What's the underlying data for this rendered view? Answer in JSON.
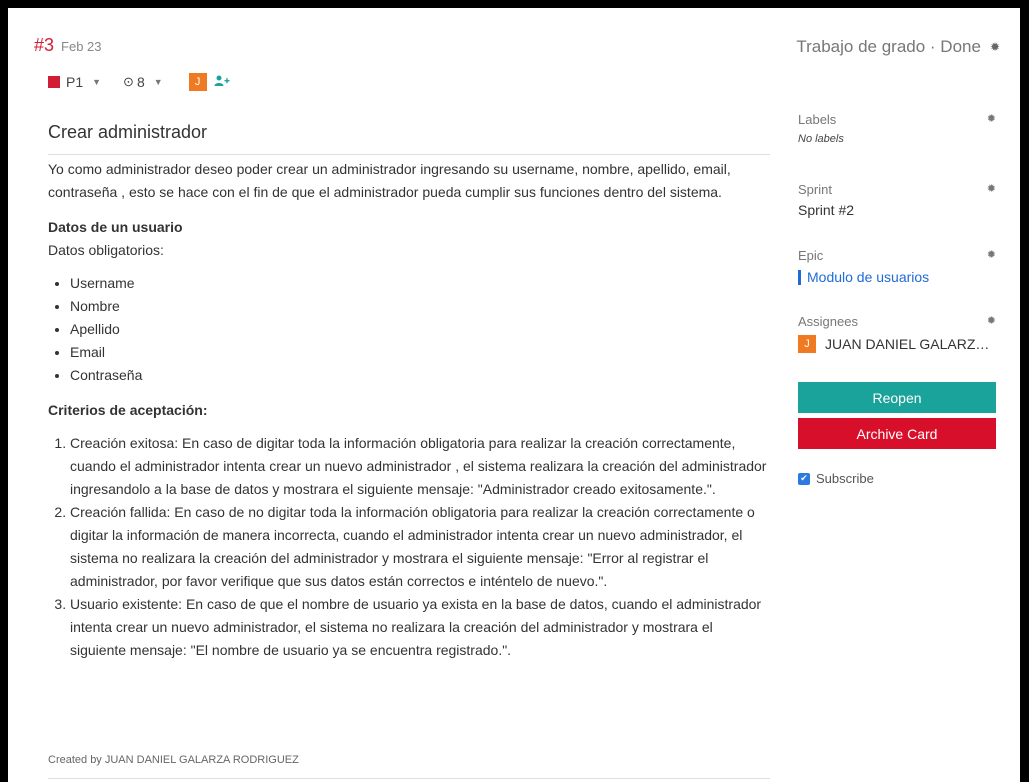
{
  "header": {
    "issue_number": "#3",
    "date": "Feb 23",
    "project_status": "Trabajo de grado · Done"
  },
  "toolbar": {
    "priority": "P1",
    "points": "8",
    "assignee_initial": "J"
  },
  "card": {
    "title": "Crear administrador",
    "description": "Yo como administrador deseo poder crear un administrador ingresando su username, nombre, apellido, email, contraseña , esto se hace con el fin de que el administrador pueda cumplir sus funciones dentro del sistema.",
    "user_data_heading": "Datos de un usuario",
    "required_label": "Datos obligatorios:",
    "required_fields": [
      "Username",
      "Nombre",
      "Apellido",
      "Email",
      "Contraseña"
    ],
    "criteria_heading": "Criterios de aceptación:",
    "criteria": [
      "Creación exitosa: En caso de digitar toda la información obligatoria para realizar la creación correctamente, cuando el administrador intenta crear un nuevo administrador , el sistema realizara la creación del administrador ingresandolo a la base de datos y mostrara el siguiente mensaje: \"Administrador creado exitosamente.\".",
      "Creación fallida: En caso de no digitar toda la información obligatoria para realizar la creación correctamente o digitar la información de manera incorrecta, cuando el administrador intenta crear un nuevo administrador, el sistema no realizara la creación del administrador y mostrara el siguiente mensaje: \"Error al registrar el administrador, por favor verifique que sus datos están correctos e inténtelo de nuevo.\".",
      "Usuario existente: En caso de que el nombre de usuario ya exista en la base de datos, cuando el administrador intenta crear un nuevo administrador, el sistema no realizara la creación del administrador y mostrara el siguiente mensaje: \"El nombre de usuario ya se encuentra registrado.\"."
    ],
    "created_by": "Created by JUAN DANIEL GALARZA RODRIGUEZ"
  },
  "sidebar": {
    "labels_label": "Labels",
    "labels_value": "No labels",
    "sprint_label": "Sprint",
    "sprint_value": "Sprint #2",
    "epic_label": "Epic",
    "epic_value": "Modulo de usuarios",
    "assignees_label": "Assignees",
    "assignee_initial": "J",
    "assignee_name": "JUAN DANIEL GALARZ…",
    "reopen_label": "Reopen",
    "archive_label": "Archive Card",
    "subscribe_label": "Subscribe"
  },
  "colors": {
    "accent_red": "#d11d35",
    "reopen_teal": "#1aa39a",
    "archive_red": "#d80f2a",
    "epic_blue": "#1f6bd6",
    "avatar_orange": "#f07a21"
  }
}
